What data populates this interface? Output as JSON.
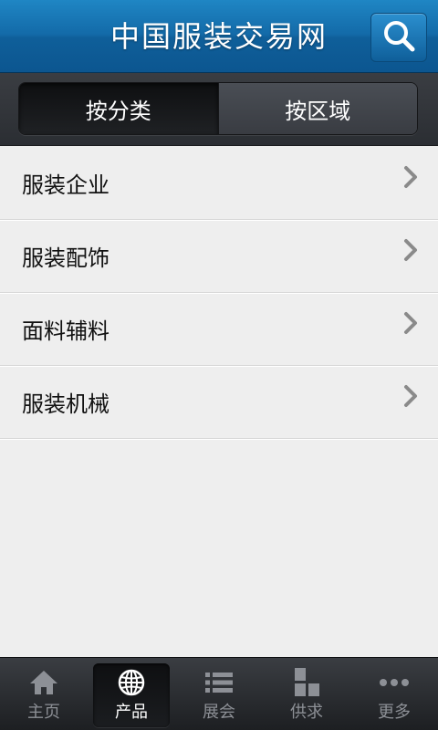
{
  "header": {
    "title": "中国服装交易网",
    "search_icon": "search-icon"
  },
  "segments": [
    {
      "label": "按分类",
      "active": true
    },
    {
      "label": "按区域",
      "active": false
    }
  ],
  "list": {
    "items": [
      {
        "label": "服装企业"
      },
      {
        "label": "服装配饰"
      },
      {
        "label": "面料辅料"
      },
      {
        "label": "服装机械"
      }
    ]
  },
  "bottom_nav": {
    "items": [
      {
        "label": "主页",
        "icon": "home-icon",
        "active": false
      },
      {
        "label": "产品",
        "icon": "globe-icon",
        "active": true
      },
      {
        "label": "展会",
        "icon": "list-icon",
        "active": false
      },
      {
        "label": "供求",
        "icon": "blocks-icon",
        "active": false
      },
      {
        "label": "更多",
        "icon": "more-icon",
        "active": false
      }
    ]
  },
  "colors": {
    "header_blue": "#136aa8",
    "bar_dark": "#2b2e33",
    "list_bg": "#eeeeee",
    "nav_inactive": "#8d9096"
  }
}
